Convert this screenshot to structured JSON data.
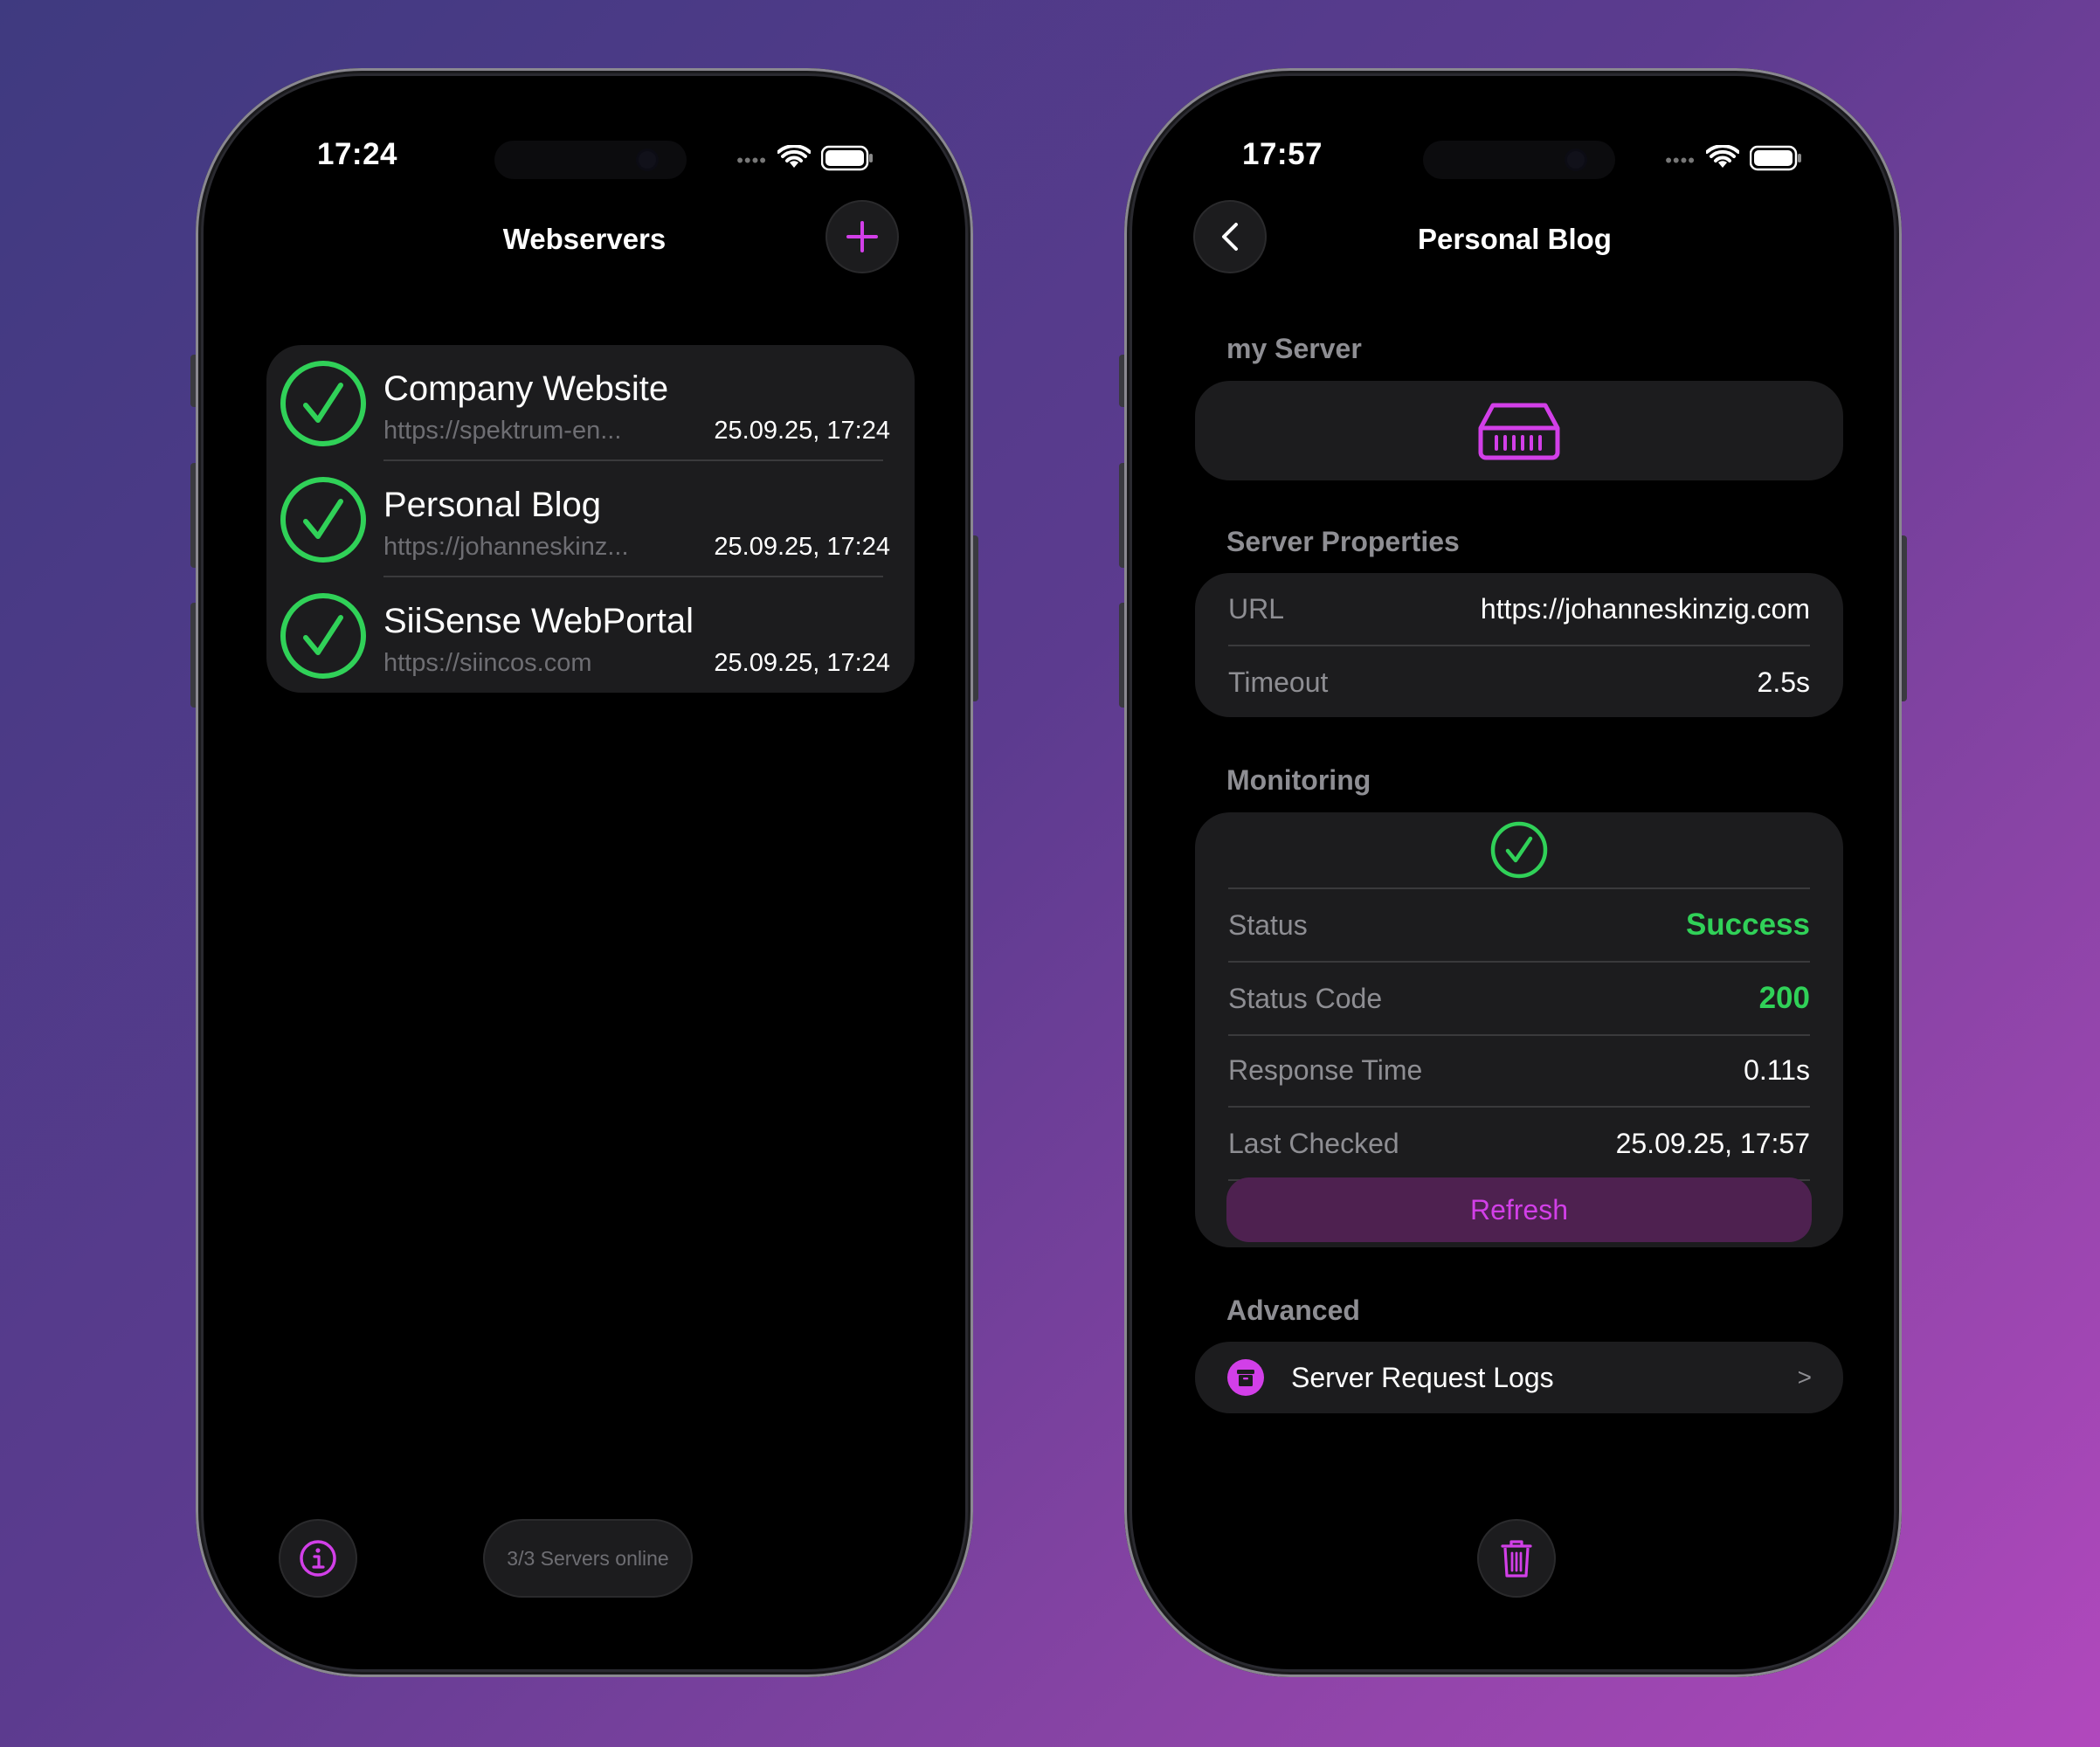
{
  "colors": {
    "accent": "#d23fe8",
    "success": "#30d158",
    "card": "#1c1c1e",
    "secondary_text": "#8e8e93"
  },
  "left_phone": {
    "status_time": "17:24",
    "nav_title": "Webservers",
    "add_icon": "plus-icon",
    "servers": [
      {
        "name": "Company Website",
        "url": "https://spektrum-en...",
        "last_checked": "25.09.25, 17:24",
        "status_icon": "check-circle-icon"
      },
      {
        "name": "Personal Blog",
        "url": "https://johanneskinz...",
        "last_checked": "25.09.25, 17:24",
        "status_icon": "check-circle-icon"
      },
      {
        "name": "SiiSense WebPortal",
        "url": "https://siincos.com",
        "last_checked": "25.09.25, 17:24",
        "status_icon": "check-circle-icon"
      }
    ],
    "info_icon": "info-icon",
    "online_summary": "3/3 Servers online"
  },
  "right_phone": {
    "status_time": "17:57",
    "back_icon": "chevron-left-icon",
    "nav_title": "Personal Blog",
    "server_section": {
      "label": "my Server",
      "icon": "server-icon"
    },
    "properties_section": {
      "label": "Server Properties",
      "url_label": "URL",
      "url_value": "https://johanneskinzig.com",
      "timeout_label": "Timeout",
      "timeout_value": "2.5s"
    },
    "monitoring_section": {
      "label": "Monitoring",
      "status_icon": "check-circle-icon",
      "status_label": "Status",
      "status_value": "Success",
      "code_label": "Status Code",
      "code_value": "200",
      "response_label": "Response Time",
      "response_value": "0.11s",
      "last_checked_label": "Last Checked",
      "last_checked_value": "25.09.25, 17:57",
      "refresh_label": "Refresh"
    },
    "advanced_section": {
      "label": "Advanced",
      "logs_label": "Server Request Logs",
      "logs_icon": "archive-icon",
      "chevron": ">"
    },
    "delete_icon": "trash-icon"
  }
}
